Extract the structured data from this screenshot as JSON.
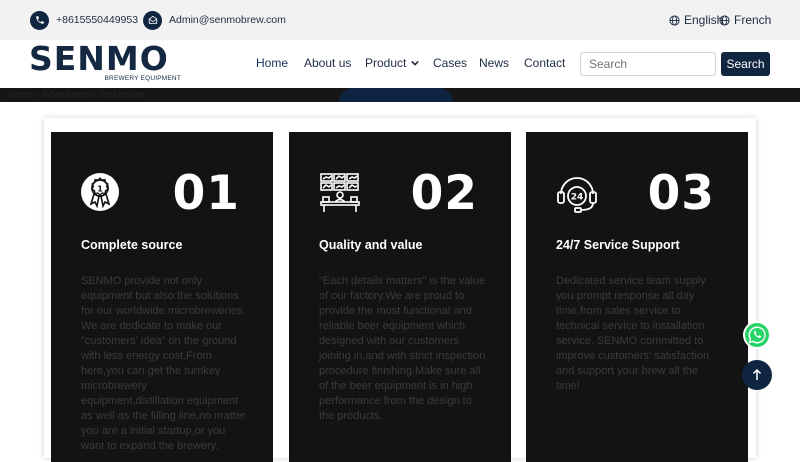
{
  "topbar": {
    "phone": "+8615550449953",
    "email": "Admin@senmobrew.com",
    "languages": [
      "English",
      "French"
    ],
    "icons": {
      "phone": "phone-icon",
      "email": "email-icon",
      "language": "globe-icon"
    }
  },
  "brand": {
    "name": "SENMO",
    "tagline": "BREWERY EQUIPMENT",
    "color": "#152842"
  },
  "nav": {
    "items": [
      "Home",
      "About us",
      "Product",
      "Cases",
      "News",
      "Contact"
    ],
    "active": "Home"
  },
  "search": {
    "placeholder": "Search",
    "button_label": "Search"
  },
  "band": {
    "ghost_text": "Home  >  Advantages  >  Technology"
  },
  "features": [
    {
      "number": "01",
      "title": "Complete source",
      "icon": "award-medal-icon",
      "text": "SENMO provide not only equipment but also the solutions for our worldwide microbreweries. We are dedicate to make our \"customers' idea\" on the ground with less energy cost.From here,you can get the turnkey microbrewery equipment,distillation equipment as well as the filling line,no matter you are a initial startup,or you want to expand the brewery."
    },
    {
      "number": "02",
      "title": "Quality and value",
      "icon": "control-room-icon",
      "text": "\"Each details matters\" is the value of our factory.We are proud to provide the most functional and reliable beer equipment which designed with our customers joining in,and with strict inspection procedure finishing.Make sure all of the beer equipment is in high performance from the design to the products."
    },
    {
      "number": "03",
      "title": "24/7 Service Support",
      "icon": "support-headset-icon",
      "text": "Dedicated service team supply you prompt response all day time,from sales service to technical service to installation service. SENMO committed to improve customers' satisfaction and support your brew all the time!"
    }
  ],
  "floating": {
    "whatsapp_icon": "whatsapp-icon",
    "back_to_top_icon": "arrow-up-icon"
  },
  "colors": {
    "navy": "#10253f",
    "card_bg": "#131313",
    "topbar_bg": "#f2f2f2",
    "whatsapp_green": "#25d366"
  }
}
